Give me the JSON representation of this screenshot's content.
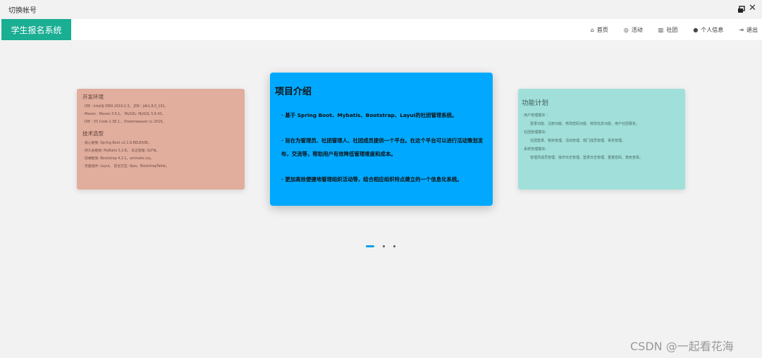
{
  "titlebar": {
    "switch_account": "切换帐号",
    "restore_icon": "window-restore-icon",
    "close_icon": "close-icon"
  },
  "header": {
    "brand": "学生报名系统",
    "brand_color": "#1aae93",
    "nav": [
      {
        "icon": "home-icon",
        "glyph": "🏠",
        "label": "首页"
      },
      {
        "icon": "activity-icon",
        "glyph": "◎",
        "label": "活动"
      },
      {
        "icon": "chart-icon",
        "glyph": "📊",
        "label": "社团"
      },
      {
        "icon": "user-icon",
        "glyph": "👤",
        "label": "个人信息"
      },
      {
        "icon": "logout-icon",
        "glyph": "⇥",
        "label": "退出"
      }
    ]
  },
  "carousel": {
    "left": {
      "title1": "开发环境",
      "lines1": [
        "· IDE : IntelliJ IDEA 2019.2.3。 JDK : jdk1.8.0_191。",
        "· Maven : Maven 3.6.1。 MySQL: MySQL 5.6.43。",
        "· IDE : VS Code 1.38.1 。Dreamweaver cc 2019。"
      ],
      "title2": "技术选型",
      "lines2": [
        "· 核心框架: Spring Boot v2.1.8.RELEASE。",
        "· 持久层框架: MyBatis 3.2.8。 日志管理: SLF4J。",
        "· 前端框架: Bootstrap 4.2.1。animate.css。",
        "· 页面组件: Layui。           前台交互: Ajax。BootstrapTable。"
      ],
      "bg": "#e1ad9d"
    },
    "center": {
      "title": "项目介绍",
      "paras": [
        "· 基于 Spring Boot、Mybatis、Bootstrap、Layui的社团管理系统。",
        "· 旨在为管理员、社团管理人、社团成员提供一个平台。在这个平台可以进行活动策划发布，交流等，帮助用户有效降低管理难度和成本。",
        "· 更加高效便捷地管理组织活动等，结合相应组织特点建立的一个信息化系统。"
      ],
      "bg": "#00a9ff"
    },
    "right": {
      "title": "功能计划",
      "items": [
        {
          "head": "· 用户管理模块 ：",
          "body": "登录功能、注册功能、修改密码功能、修改信息功能、用户社团报名。"
        },
        {
          "head": "· 社团管理模块：",
          "body": "社团登录、物资管理、活动管理、部门成员管理、事务管理。"
        },
        {
          "head": "· 系统管理模块：",
          "body": "管理员成员管理、操作日志管理、登录日志管理、重置密码、角色查看。"
        }
      ],
      "bg": "#a1e0da"
    },
    "indicator": {
      "count": 3,
      "active": 0
    }
  },
  "watermark": "CSDN @一起看花海"
}
